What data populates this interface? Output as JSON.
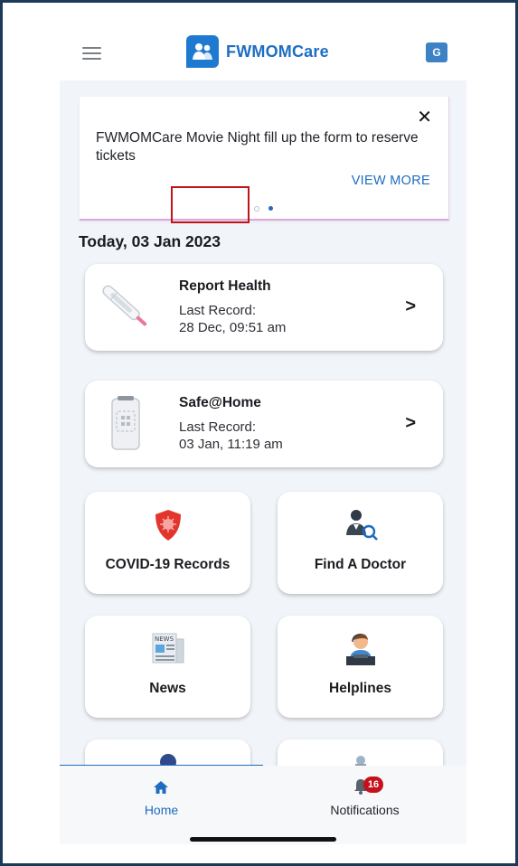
{
  "app": {
    "name": "FWMOMCare",
    "translate_label": "G"
  },
  "banner": {
    "message": "FWMOMCare Movie Night fill up the form to reserve tickets",
    "action_label": "VIEW MORE",
    "close_glyph": "✕",
    "pages": 2,
    "active_page": 2
  },
  "today": "Today, 03 Jan 2023",
  "cards": [
    {
      "title": "Report Health",
      "line1": "Last Record:",
      "line2": "28 Dec, 09:51 am",
      "icon": "thermometer-icon"
    },
    {
      "title": "Safe@Home",
      "line1": "Last Record:",
      "line2": "03 Jan, 11:19 am",
      "icon": "device-icon"
    }
  ],
  "tiles": [
    {
      "label": "COVID-19 Records",
      "icon": "virus-shield-icon"
    },
    {
      "label": "Find A Doctor",
      "icon": "doctor-search-icon"
    },
    {
      "label": "News",
      "icon": "newspaper-icon"
    },
    {
      "label": "Helplines",
      "icon": "helpdesk-icon"
    }
  ],
  "tabs": {
    "home": {
      "label": "Home",
      "icon": "home-icon"
    },
    "notifications": {
      "label": "Notifications",
      "icon": "bell-icon",
      "badge": "16"
    }
  },
  "colors": {
    "accent": "#1f6bbf",
    "highlight_box": "#c0141a",
    "badge": "#c4111b",
    "frame": "#1b3a57"
  }
}
